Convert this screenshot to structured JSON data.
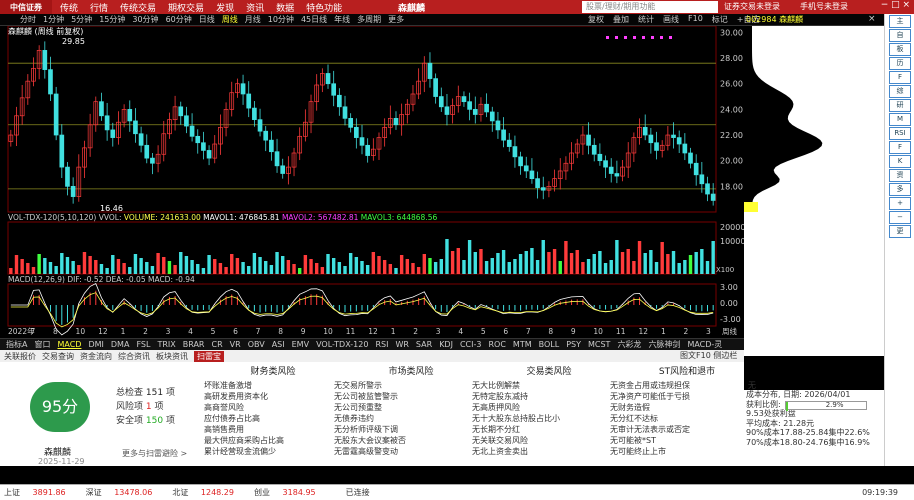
{
  "topbar": {
    "logo": "中信证券",
    "mode": "传统",
    "menus": [
      "行情",
      "传统交易",
      "期权交易",
      "发现",
      "资讯",
      "数据",
      "特色功能"
    ],
    "title": "森麒麟",
    "search_placeholder": "股票/理财/期用功能",
    "trade": "证券交易未登录",
    "phone": "手机号未登录",
    "winbtns": "− □ ×"
  },
  "toolbar": {
    "timeframes": [
      "分时",
      "1分钟",
      "5分钟",
      "15分钟",
      "30分钟",
      "60分钟",
      "日线",
      "周线",
      "月线",
      "10分钟",
      "45日线",
      "年线",
      "多周期",
      "更多"
    ],
    "active": "周线",
    "right": [
      "复权",
      "叠加",
      "统计",
      "画线",
      "F10",
      "标记",
      "+自选"
    ],
    "code": "002984",
    "name": "森麒麟"
  },
  "chart_head": "森麒麟 (周线 前复权)",
  "price_labels": {
    "high": "29.85",
    "low": "16.46",
    "axis": [
      "30.00",
      "28.00",
      "26.00",
      "24.00",
      "22.00",
      "20.00",
      "18.00"
    ]
  },
  "vol_head": {
    "title": "VOL-TDX-120(5,10,120)  VVOL: ",
    "volume": "VOLUME: 241633.00",
    "mavol1": "MAVOL1: 476845.81",
    "mavol2": "MAVOL2: 567482.81",
    "mavol3": "MAVOL3: 644868.56",
    "axis": [
      "20000",
      "10000"
    ],
    "unit": "X100"
  },
  "macd_head": {
    "title": "MACD(12,26,9) DIF: -0.52 DEA: -0.05 MACD: -0.94",
    "axis": [
      "3.00",
      "0.00",
      "-3.00"
    ]
  },
  "xaxis": [
    "2022年",
    "7",
    "8",
    "10",
    "12",
    "1",
    "2",
    "3",
    "4",
    "5",
    "6",
    "7",
    "8",
    "9",
    "10",
    "11",
    "12",
    "1",
    "2",
    "3",
    "4",
    "5",
    "6",
    "7",
    "8",
    "9",
    "10",
    "11",
    "12",
    "1",
    "2",
    "3"
  ],
  "xaxis_right": "周线",
  "tabs": [
    "指标A",
    "窗口",
    "MACD",
    "DMI",
    "DMA",
    "FSL",
    "TRIX",
    "BRAR",
    "CR",
    "VR",
    "OBV",
    "ASI",
    "EMV",
    "VOL-TDX-120",
    "RSI",
    "WR",
    "SAR",
    "KDJ",
    "CCI-3",
    "ROC",
    "MTM",
    "BOLL",
    "PSY",
    "MCST",
    "六彩龙",
    "六脉神剑",
    "MACD-灵"
  ],
  "active_tab": "MACD",
  "subtabs": [
    "关联报价",
    "交易查询",
    "资金流向",
    "综合资讯",
    "板块资讯",
    "扫雷宝"
  ],
  "active_subtab": "扫雷宝",
  "subtab_right": "图文F10 侧边栏",
  "risk": {
    "score": "95分",
    "name": "森麒麟",
    "date": "2025-11-29",
    "total_label": "总检查",
    "total": "151",
    "total_unit": "项",
    "risk_label": "风险项",
    "risk_count": "1",
    "risk_unit": "项",
    "safe_label": "安全项",
    "safe": "150",
    "safe_unit": "项",
    "more": "更多与扫雷避险 >",
    "cols": [
      {
        "head": "财务类风险",
        "rows": [
          [
            "坏账准备激增",
            "无"
          ],
          [
            "高研发费用资本化",
            "无"
          ],
          [
            "高商誉风险",
            "无"
          ],
          [
            "应付债券占比高",
            "无"
          ],
          [
            "高销售费用",
            "无"
          ],
          [
            "最大供应商采购占比高",
            "无"
          ],
          [
            "累计经营现金流偏少",
            "无"
          ]
        ]
      },
      {
        "head": "市场类风险",
        "rows": [
          [
            "交易所警示",
            "无"
          ],
          [
            "公司被监管警示",
            "无"
          ],
          [
            "公司预重整",
            "无"
          ],
          [
            "债券违约",
            "无"
          ],
          [
            "分析师评级下调",
            "无"
          ],
          [
            "股东大会议案被否",
            "无"
          ],
          [
            "雷霆高级警变动",
            "无"
          ]
        ]
      },
      {
        "head": "交易类风险",
        "rows": [
          [
            "大比例解禁",
            "无"
          ],
          [
            "特定股东减持",
            "无"
          ],
          [
            "高质押风险",
            "无"
          ],
          [
            "十大股东总持股占比小",
            "无"
          ],
          [
            "长期不分红",
            "无"
          ],
          [
            "关联交易风险",
            "无"
          ],
          [
            "北上资金卖出",
            "无"
          ]
        ]
      },
      {
        "head": "ST风险和退市",
        "rows": [
          [
            "资金占用或违规担保",
            "无"
          ],
          [
            "净资产可能低于亏损",
            "无"
          ],
          [
            "财务造假",
            "无"
          ],
          [
            "分红不达标",
            "无"
          ],
          [
            "审计无法表示或否定",
            "无"
          ],
          [
            "可能被*ST",
            "无"
          ],
          [
            "可能终止上市",
            "无"
          ]
        ]
      }
    ]
  },
  "cost": {
    "l1": "成本分布, 日期: 2026/04/01",
    "l2": "获利比例:",
    "pct": "2.9%",
    "l3": "9.53处获利盘",
    "l4": "平均成本: 21.28元",
    "l5": "90%成本17.88-25.84集中22.6%",
    "l6": "70%成本18.80-24.76集中16.9%"
  },
  "bottom": {
    "items": [
      {
        "name": "上证",
        "value": "3891.86",
        "cls": "up"
      },
      {
        "name": "深证",
        "value": "13478.06",
        "cls": "up"
      },
      {
        "name": "北证",
        "value": "1248.29",
        "cls": "up"
      },
      {
        "name": "创业",
        "value": "3184.95",
        "cls": "up"
      },
      {
        "name": "",
        "value": "已连接",
        "cls": ""
      }
    ],
    "time": "09:19:39"
  },
  "rightside": [
    "主",
    "自",
    "板",
    "历",
    "F",
    "综",
    "研",
    "M",
    "RSI",
    "F",
    "K",
    "资",
    "多",
    "+",
    "−",
    "更"
  ],
  "colors": {
    "up": "#ff3b3b",
    "down": "#41e0e0",
    "yellow": "#ffff4c",
    "white": "#ffffff",
    "magenta": "#ff40ff",
    "green": "#40ff40"
  },
  "chart_data": {
    "type": "candlestick",
    "weekly_close": [
      22.0,
      23.5,
      24.9,
      26.2,
      27.2,
      28.6,
      27.1,
      25.2,
      22.0,
      19.5,
      18.0,
      17.2,
      19.5,
      21.0,
      22.8,
      24.6,
      23.5,
      22.4,
      21.8,
      23.0,
      24.0,
      23.1,
      22.1,
      21.2,
      20.2,
      19.8,
      20.5,
      22.1,
      23.2,
      24.2,
      23.5,
      22.7,
      21.9,
      21.4,
      20.8,
      20.2,
      21.3,
      22.6,
      24.0,
      25.3,
      26.0,
      25.2,
      24.1,
      23.2,
      22.3,
      21.6,
      20.7,
      19.6,
      19.0,
      19.5,
      20.6,
      21.9,
      23.0,
      24.6,
      25.9,
      26.8,
      26.0,
      25.1,
      24.2,
      23.3,
      22.6,
      21.8,
      21.2,
      20.4,
      20.9,
      21.8,
      22.6,
      23.3,
      22.8,
      23.6,
      24.4,
      25.2,
      26.2,
      27.6,
      26.4,
      25.0,
      24.2,
      23.6,
      24.3,
      25.0,
      24.6,
      24.0,
      23.6,
      24.4,
      23.8,
      23.1,
      22.4,
      21.6,
      21.1,
      20.3,
      19.6,
      19.2,
      18.6,
      17.9,
      17.7,
      18.0,
      18.6,
      19.2,
      19.8,
      20.6,
      21.3,
      22.0,
      21.2,
      20.5,
      20.0,
      19.5,
      19.0,
      18.8,
      19.5,
      20.6,
      21.8,
      22.6,
      22.0,
      21.4,
      20.8,
      21.2,
      22.0,
      21.8,
      21.3,
      20.6,
      19.8,
      18.9,
      18.2,
      17.4,
      16.9
    ],
    "volume_hint": "weekly volume bars, recent weeks larger",
    "y_range": [
      16.0,
      30.5
    ]
  }
}
